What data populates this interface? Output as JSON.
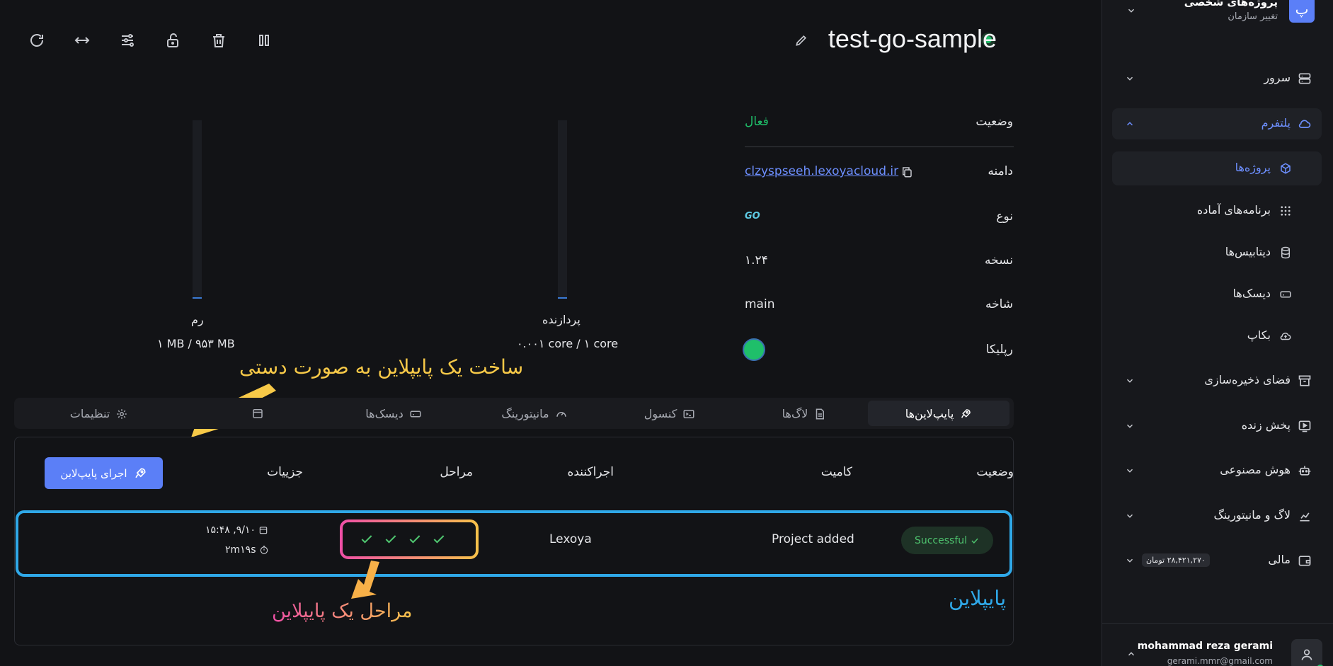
{
  "header": {
    "title": "test-go-sample",
    "status_color": "#1fbf6a",
    "toolbar": [
      "refresh-icon",
      "arrows-horizontal-icon",
      "sliders-icon",
      "unlock-icon",
      "trash-icon",
      "pause-icon",
      "pencil-icon"
    ]
  },
  "info": {
    "status_label": "وضعیت",
    "status_value": "فعال",
    "domain_label": "دامنه",
    "domain_value": "clzyspseeh.lexoyacloud.ir",
    "type_label": "نوع",
    "type_value": "GO",
    "version_label": "نسخه",
    "version_value": "۱.۲۴",
    "branch_label": "شاخه",
    "branch_value": "main",
    "replica_label": "رپلیکا",
    "replica_color": "#1fbf6a"
  },
  "resources": {
    "cpu_label": "پردازنده",
    "cpu_value": "۰.۰۰۱ core / ۱ core",
    "cpu_fraction": 0.001,
    "ram_label": "رم",
    "ram_value": "۱ MB / ۹۵۳ MB",
    "ram_fraction": 0.001
  },
  "annotations": {
    "manual_pipeline": "ساخت یک پایپلاین به صورت دستی",
    "pipeline_steps": "مراحل یک پایپلاین",
    "pipeline": "پایپلاین"
  },
  "tabs": [
    {
      "label": "پایپ‌لاین‌ها",
      "icon": "rocket-icon"
    },
    {
      "label": "لاگ‌ها",
      "icon": "file-icon"
    },
    {
      "label": "کنسول",
      "icon": "terminal-icon"
    },
    {
      "label": "مانیتورینگ",
      "icon": "gauge-icon"
    },
    {
      "label": "دیسک‌ها",
      "icon": "disk-icon"
    },
    {
      "label": "",
      "icon": "calendar-icon"
    },
    {
      "label": "تنظیمات",
      "icon": "gear-icon"
    }
  ],
  "pipelines": {
    "columns": {
      "status": "وضعیت",
      "commit": "کامیت",
      "runner": "اجراکننده",
      "steps": "مراحل",
      "details": "جزییات"
    },
    "run_button": "اجرای پایپ‌لاین",
    "rows": [
      {
        "status": "Successful",
        "commit": "Project added",
        "runner": "Lexoya",
        "steps_done": 4,
        "date": "۱۵:۴۸ ,۹/۱۰",
        "duration": "۲m۱۹s"
      }
    ]
  },
  "sidebar": {
    "org_letter": "پ",
    "org_title": "پروژه‌های شخصی",
    "org_sub": "تغییر سازمان",
    "items": [
      {
        "label": "سرور",
        "icon": "server-icon"
      },
      {
        "label": "پلتفرم",
        "icon": "cloud-icon"
      },
      {
        "label": "فضای ذخیره‌سازی",
        "icon": "archive-icon"
      },
      {
        "label": "پخش زنده",
        "icon": "live-icon"
      },
      {
        "label": "هوش مصنوعی",
        "icon": "robot-icon"
      },
      {
        "label": "لاگ و مانیتورینگ",
        "icon": "chart-icon"
      },
      {
        "label": "مالی",
        "icon": "wallet-icon"
      }
    ],
    "sub_items": [
      {
        "label": "پروژه‌ها",
        "icon": "cube-icon"
      },
      {
        "label": "برنامه‌های آماده",
        "icon": "grid-icon"
      },
      {
        "label": "دیتابیس‌ها",
        "icon": "database-icon"
      },
      {
        "label": "دیسک‌ها",
        "icon": "disk-icon"
      },
      {
        "label": "بکاپ",
        "icon": "cloud-upload-icon"
      }
    ],
    "balance": "۲۸,۴۲۱,۲۷۰ تومان",
    "user_name": "mohammad reza gerami",
    "user_email": "gerami.mmr@gmail.com"
  }
}
